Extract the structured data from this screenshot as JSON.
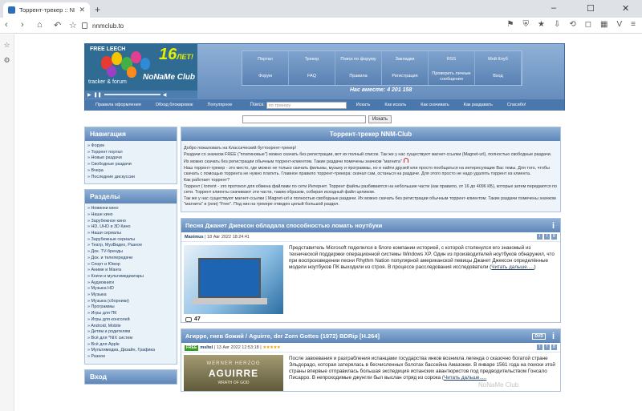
{
  "browser": {
    "tab_title": "Торрент-трекер :: NNM",
    "url": "nnmclub.to"
  },
  "header": {
    "free_leech": "FREE LEECH",
    "anniversary": "16",
    "anniversary_word": "ЛЕТ!",
    "logo_name": "NoNaMe Club",
    "tracker_forum": "tracker & forum",
    "nav_top": [
      "Портал",
      "Трекер",
      "Поиск по форуму",
      "Закладки",
      "RSS",
      "Мой Клуб"
    ],
    "nav_bottom": [
      "Форум",
      "FAQ",
      "Правила",
      "Регистрация",
      "Проверить личные сообщения",
      "Вход"
    ],
    "online_label": "Нас вместе:",
    "online_count": "4 201 158",
    "strip_links_left": [
      "Правила оформления",
      "Обход блокировок",
      "Популярное"
    ],
    "search_label": "Поиск:",
    "search_placeholder": "по трекеру",
    "search_button": "Искать",
    "strip_links_right": [
      "Как искать",
      "Как скачивать",
      "Как раздавать",
      "Спасибо!"
    ]
  },
  "top_search": {
    "button": "Искать"
  },
  "sidebar": {
    "nav_title": "Навигация",
    "nav_items": [
      "» Форум",
      "» Торрент портал",
      "» Новые раздачи",
      "» Свободные раздачи",
      "» Вчера",
      "» Последние дискуссии"
    ],
    "sections_title": "Разделы",
    "sections": [
      "» Новинки кино",
      "» Наше кино",
      "» Зарубежное кино",
      "» HD, UHD и 3D Кино",
      "» Наши сериалы",
      "» Зарубежные сериалы",
      "» Театр, МузВидео, Разное",
      "» Док. TV-бренды",
      "» Док. и телепередачи",
      "» Спорт и Юмор",
      "» Аниме и Манга",
      "» Книги и мультимедиатары",
      "» Аудиокниги",
      "» Музыка HD",
      "» Музыка",
      "» Музыка (сборники)",
      "» Программы",
      "» Игры для ПК",
      "» Игры для консолей",
      "» Android, Mobile",
      "» Детям и родителям",
      "» Всё для *NIX систем",
      "» Всё для Apple",
      "» Мультимедиа, Дизайн, Графика",
      "» Разное"
    ],
    "login_title": "Вход"
  },
  "welcome": {
    "title": "Торрент-трекер NNM-Club",
    "p1": "Добро пожаловать на Классический буттоорент-трекер!",
    "p2": "Раздачи со значком FREE (\"платиновые\") можно скачать без регистрации, вот их полный список. Так же у нас существуют магнет-ссылки (Magnet-url), полностью свободные раздачи. Их можно скачать без регистрации обычным торрент-клиентом. Такие раздачи помечены значком \"магнита\"",
    "p3": "Наш торрент-трекер - это место, где можно не только скачать фильмы, музыку и программы, но и найти друзей или просто пообщаться на интересующие Вас темы. Для того, чтобы скачать с помощью торрента не нужно платить. Главное правило торрент-трекера: скачал сам, останься на раздаче. Для этого просто не надо удалять торрент из клиента.",
    "p4": "Как работает торрент?",
    "p5": "Торрент ( torrent - это протокол для обмена файлами по сети Интернет. Торрент файлы разбиваются на небольшие части (как правило, от 16 до 4096 КБ), которые затем передаются по сети. Торрент клиенты скачивают эти части, таким образом, собирая исходный файл целиком.",
    "p6": "Так же у нас существуют магнет-ссылки ( Magnet-url и полностью свободные раздачи. Их можно скачать без регистрации обычным торрент-клиентом. Такие раздачи помечены значком \"магнита\" и (или) \"Free\". Под ник на трекере отведен целый большой раздел."
  },
  "news1": {
    "title": "Песня Джанет Джексон обладала способностью ломать ноутбуки",
    "author": "Maximus",
    "date": "18 Авг 2022 18:24:41",
    "text": "Представитель Microsoft поделился в блоге компании историей, с которой столкнулся его знакомый из технической поддержки операционной системы Windows XP. Один из производителей ноутбуков обнаружил, что при воспроизведении песни Rhythm Nation популярной американской певицы Джанет Джексон определённые модели ноутбуков ПК выходили из строя. В процессе расследования исследователи (",
    "readmore": "Читать дальше.....",
    "readmore_close": ")",
    "comments": "47"
  },
  "news2": {
    "title": "Агирре, гнев божий / Aguirre, der Zorn Gottes (1972) BDRip [H.264]",
    "badge": "FREE",
    "author": "msltel",
    "date": "13 Авг 2022 12:53:18",
    "stars": "★★★★★",
    "poster_top": "WERNER HERZOG",
    "poster_title": "AGUIRRE",
    "poster_sub": "WRATH OF GOD",
    "text": "После завоевания и разграбления испанцами государства инков возникла легенда о сказочно богатой стране Эльдорадо, которая затерялась в бесчисленных болотах бассейна Амазонки. В январе 1561 года на поиски этой страны впервые отправилась большая экспедиция испанских авантюристов под предводительством Гонсало Писарро. В непроходимые джунгли был выслан отряд из сорока (",
    "readmore": "Читать дальше.....",
    "watermark": "NoNaMe Club"
  }
}
